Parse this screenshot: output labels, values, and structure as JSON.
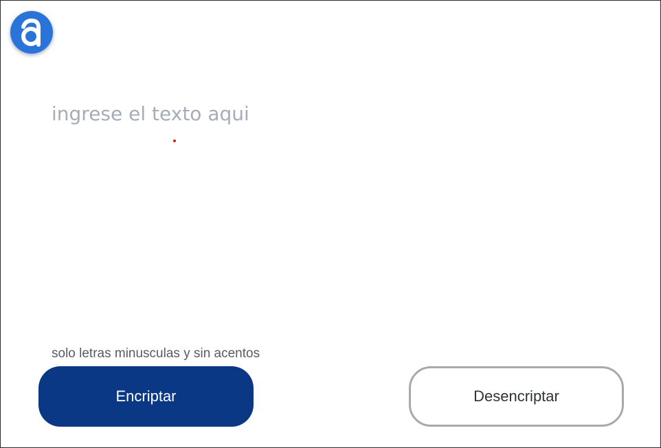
{
  "logo": {
    "letter": "a",
    "color": "#2a73d9"
  },
  "input": {
    "placeholder": "ingrese el texto aqui",
    "value": ""
  },
  "hint": {
    "text": "solo letras minusculas y sin acentos"
  },
  "buttons": {
    "encrypt_label": "Encriptar",
    "decrypt_label": "Desencriptar",
    "encrypt_color": "#0a3885"
  }
}
